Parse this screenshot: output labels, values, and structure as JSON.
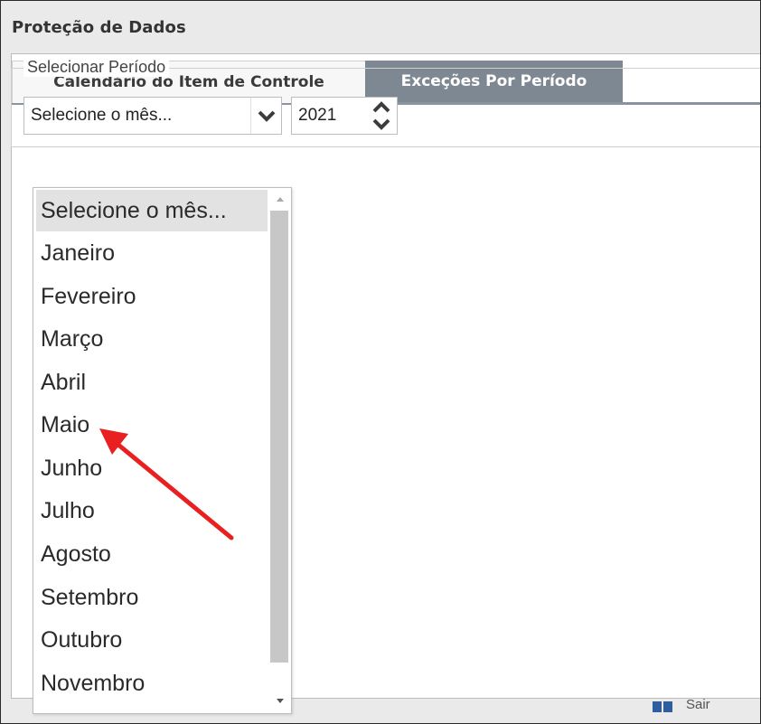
{
  "window": {
    "title": "Proteção de Dados"
  },
  "tabs": [
    {
      "label": "Calendário do Item de Controle",
      "active": false
    },
    {
      "label": "Exceções Por Período",
      "active": true
    }
  ],
  "period_group": {
    "legend": "Selecionar Período",
    "month_select": {
      "value": "Selecione o mês..."
    },
    "year_spinner": {
      "value": "2021"
    }
  },
  "month_dropdown": {
    "options": [
      "Selecione o mês...",
      "Janeiro",
      "Fevereiro",
      "Março",
      "Abril",
      "Maio",
      "Junho",
      "Julho",
      "Agosto",
      "Setembro",
      "Outubro",
      "Novembro"
    ],
    "highlighted_index": 0
  },
  "footer": {
    "button_label": "Sair"
  },
  "colors": {
    "active_tab": "#7e8893",
    "annotation_arrow": "#e8201f",
    "highlight": "#e2e2e2"
  },
  "icons": {
    "select_arrow": "chevron-down-icon",
    "spin_up": "chevron-up-icon",
    "spin_down": "chevron-down-icon",
    "annotation": "red-arrow-icon"
  }
}
